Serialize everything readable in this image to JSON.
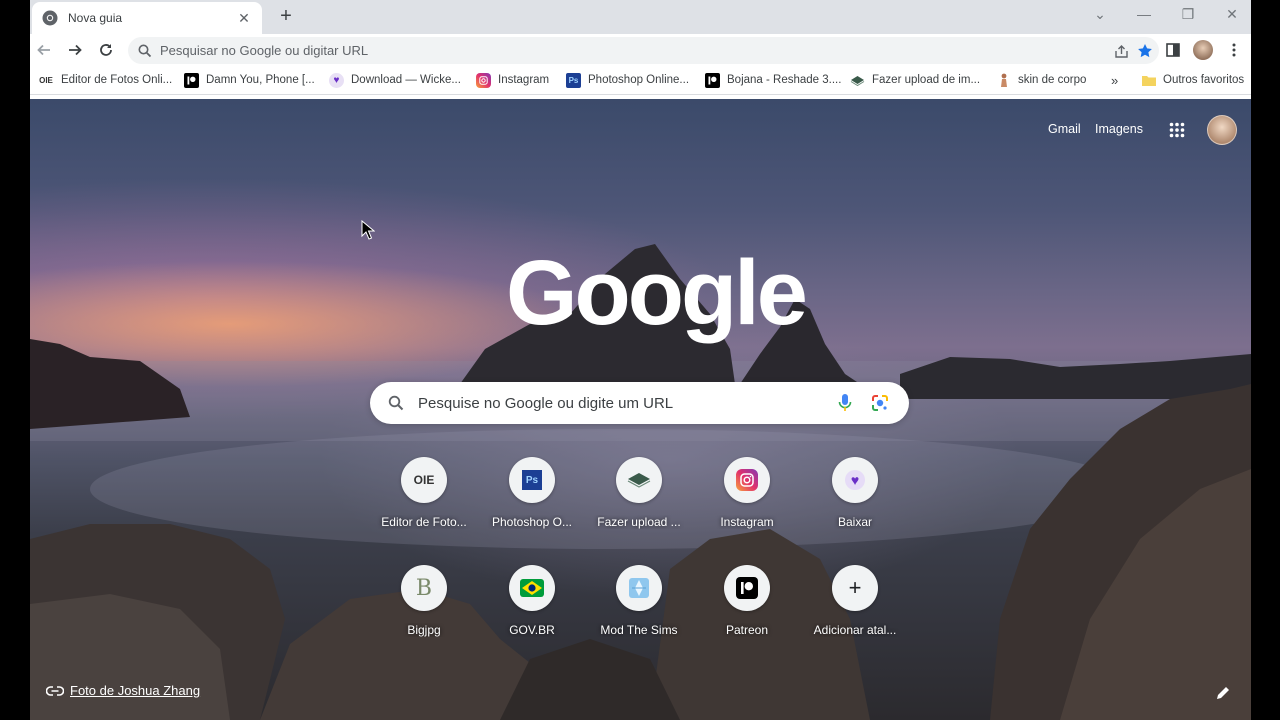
{
  "tab": {
    "title": "Nova guia"
  },
  "omnibox": {
    "placeholder": "Pesquisar no Google ou digitar URL"
  },
  "bookmarks": {
    "items": [
      {
        "label": "Editor de Fotos Onli...",
        "icon": "oie-icon"
      },
      {
        "label": "Damn You, Phone [...",
        "icon": "patreon-icon"
      },
      {
        "label": "Download — Wicke...",
        "icon": "heart-icon"
      },
      {
        "label": "Instagram",
        "icon": "instagram-icon"
      },
      {
        "label": "Photoshop Online...",
        "icon": "photoshop-icon"
      },
      {
        "label": "Bojana - Reshade 3....",
        "icon": "patreon-icon"
      },
      {
        "label": "Fazer upload de im...",
        "icon": "layers-icon"
      },
      {
        "label": "skin de corpo",
        "icon": "figure-icon"
      }
    ],
    "overflow": "»",
    "other_favorites": "Outros favoritos"
  },
  "ntp": {
    "gmail": "Gmail",
    "images": "Imagens",
    "logo": "Google",
    "search_placeholder": "Pesquise no Google ou digite um URL",
    "shortcuts": [
      {
        "label": "Editor de Foto...",
        "icon": "oie-icon",
        "icon_text": "OIE"
      },
      {
        "label": "Photoshop O...",
        "icon": "photoshop-icon",
        "icon_text": "Ps"
      },
      {
        "label": "Fazer upload ...",
        "icon": "layers-icon",
        "icon_text": ""
      },
      {
        "label": "Instagram",
        "icon": "instagram-icon",
        "icon_text": ""
      },
      {
        "label": "Baixar",
        "icon": "heart-icon",
        "icon_text": ""
      },
      {
        "label": "Bigjpg",
        "icon": "bigjpg-icon",
        "icon_text": "B"
      },
      {
        "label": "GOV.BR",
        "icon": "govbr-icon",
        "icon_text": ""
      },
      {
        "label": "Mod The Sims",
        "icon": "modthesims-icon",
        "icon_text": ""
      },
      {
        "label": "Patreon",
        "icon": "patreon-icon",
        "icon_text": ""
      },
      {
        "label": "Adicionar atal...",
        "icon": "plus-icon",
        "icon_text": "+"
      }
    ],
    "photo_credit": "Foto de Joshua Zhang"
  },
  "colors": {
    "accent_blue": "#1a73e8",
    "tabstrip": "#dee1e6",
    "omnibox_bg": "#f1f3f4"
  }
}
